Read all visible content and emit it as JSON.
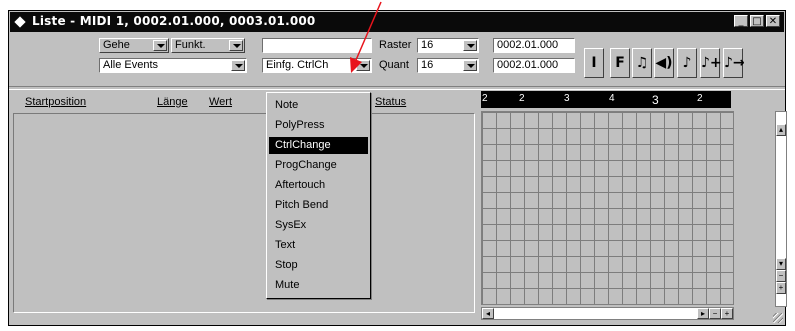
{
  "window": {
    "title": "Liste - MIDI 1, 0002.01.000, 0003.01.000"
  },
  "title_buttons": {
    "minimize": "_",
    "maximize": "□",
    "close": "✕"
  },
  "toolbar": {
    "goto_label": "Gehe",
    "funkt_label": "Funkt.",
    "filter_value": "Alle Events",
    "insert_value": "Einfg. CtrlChange",
    "insert_display": "Einfg. CtrlCh",
    "empty_field": "",
    "raster_label": "Raster",
    "raster_value": "16",
    "quant_label": "Quant",
    "quant_value": "16",
    "position_top": "0002.01.000",
    "position_bottom": "0002.01.000",
    "tools": [
      "I",
      "F",
      "♫",
      "◀)",
      "♪",
      "♪+",
      "♪→"
    ]
  },
  "columns": {
    "start": "Startposition",
    "length": "Länge",
    "value": "Wert",
    "status": "Status"
  },
  "dropdown": {
    "items": [
      "Note",
      "PolyPress",
      "CtrlChange",
      "ProgChange",
      "Aftertouch",
      "Pitch Bend",
      "SysEx",
      "Text",
      "Stop",
      "Mute"
    ],
    "selected": "CtrlChange"
  },
  "ruler": {
    "labels": [
      "2",
      "2",
      "3",
      "4",
      "3",
      "2"
    ]
  },
  "colors": {
    "annotation_arrow": "#e8141c",
    "selection": "#000000",
    "panel": "#c0c0c0"
  }
}
